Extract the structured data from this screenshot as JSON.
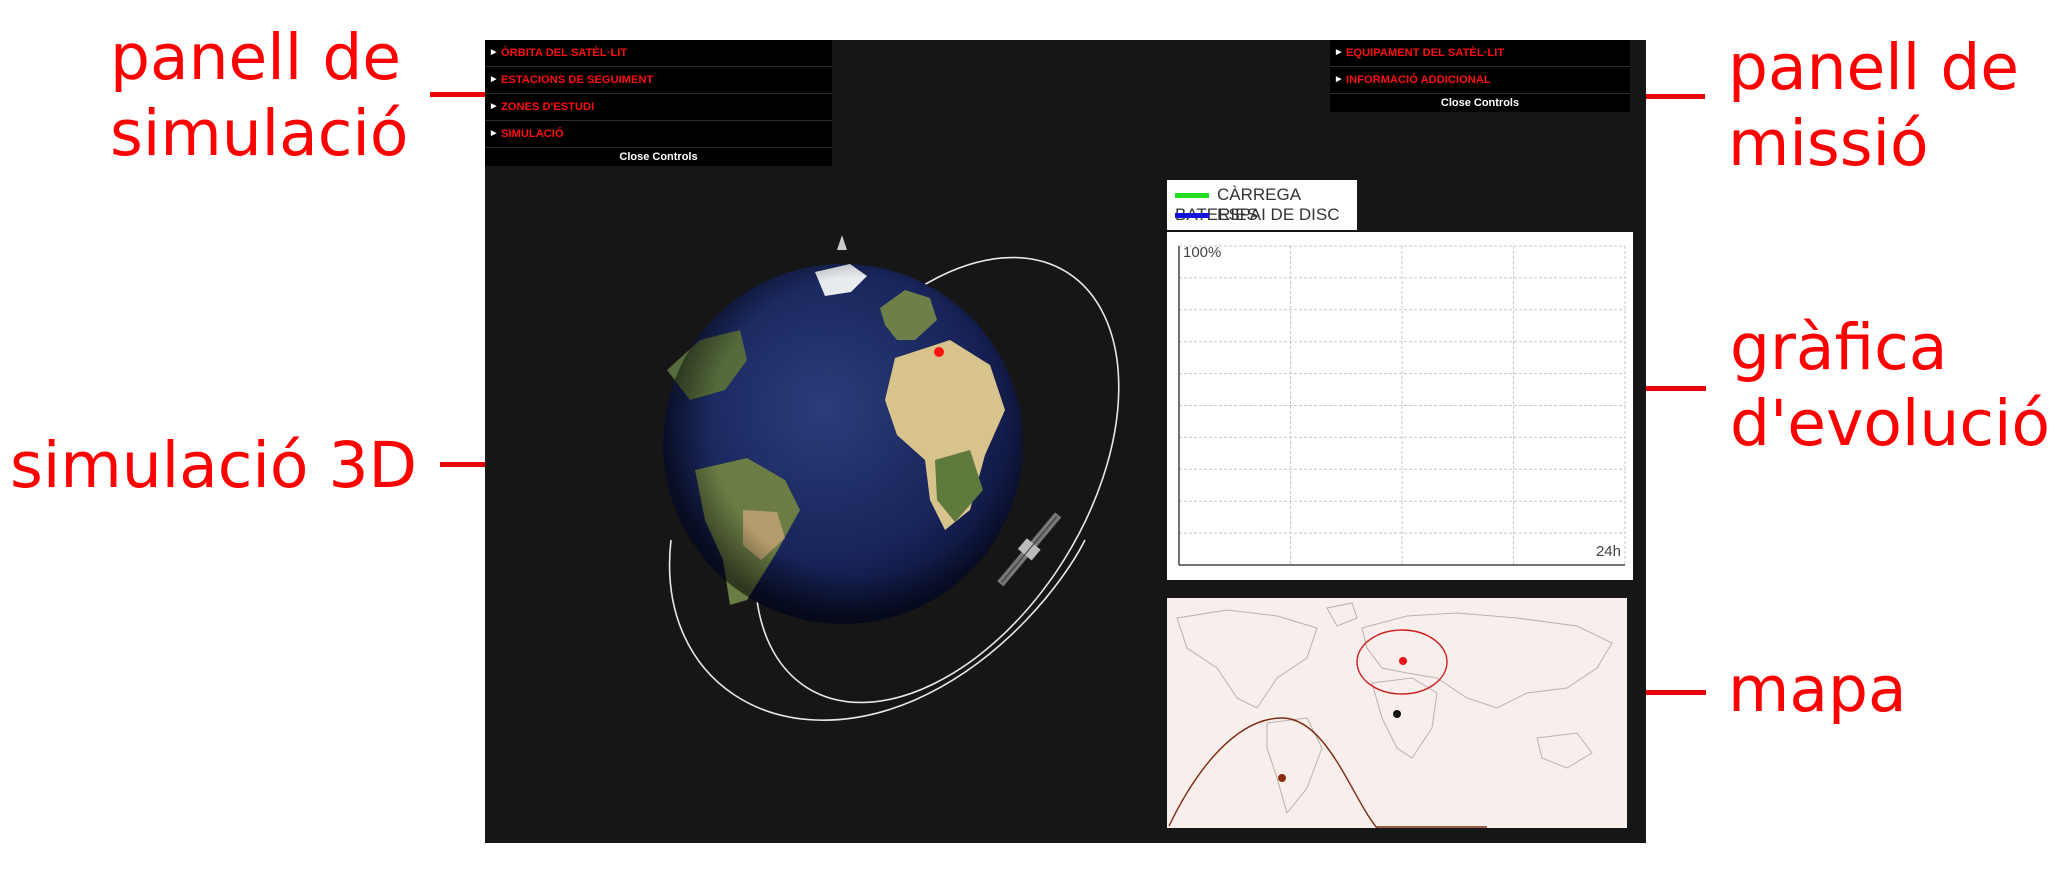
{
  "annotations": {
    "simulation_panel": "panell de\nsimulació",
    "mission_panel": "panell de\nmissió",
    "simulation_3d": "simulació 3D",
    "evolution_chart": "gràfica\nd'evolució",
    "map": "mapa"
  },
  "simulation_panel": {
    "items": [
      {
        "label": "Òrbita del satèl·lit"
      },
      {
        "label": "Estacions de seguiment"
      },
      {
        "label": "Zones d'estudi"
      },
      {
        "label": "Simulació"
      }
    ],
    "close_label": "Close Controls"
  },
  "mission_panel": {
    "items": [
      {
        "label": "Equipament del satèl·lit"
      },
      {
        "label": "Informació addicional"
      }
    ],
    "close_label": "Close Controls"
  },
  "legend": {
    "items": [
      {
        "label": "CÀRREGA BATERIES",
        "color": "#22dd22"
      },
      {
        "label": "ESPAI DE DISC",
        "color": "#1111dd"
      }
    ]
  },
  "chart": {
    "y_max_label": "100%",
    "x_max_label": "24h"
  },
  "colors": {
    "annotation": "#ff0000",
    "menu_text": "#ff0e0e",
    "app_background": "#161616"
  },
  "icons": [
    "earth-globe-icon",
    "satellite-icon",
    "orbit-path-icon",
    "world-map-icon"
  ]
}
